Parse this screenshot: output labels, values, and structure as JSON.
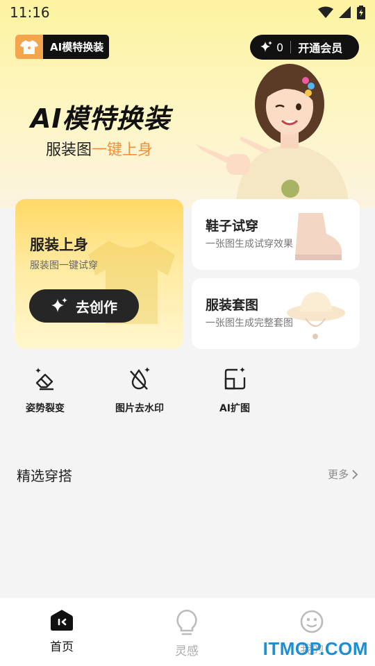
{
  "status_bar": {
    "time": "11:16"
  },
  "header": {
    "app_badge_label": "AI模特换装",
    "credits_count": "0",
    "vip_button_label": "开通会员"
  },
  "hero": {
    "title": "AI模特换装",
    "subtitle_plain": "服装图",
    "subtitle_accent": "一键上身"
  },
  "features": {
    "main": {
      "title": "服装上身",
      "subtitle": "服装图一键试穿",
      "button_label": "去创作"
    },
    "shoes": {
      "title": "鞋子试穿",
      "subtitle": "一张图生成试穿效果"
    },
    "outfit_set": {
      "title": "服装套图",
      "subtitle": "一张图生成完整套图"
    }
  },
  "tools": [
    {
      "label": "姿势裂变",
      "icon": "eraser-sparkle-icon"
    },
    {
      "label": "图片去水印",
      "icon": "no-droplet-icon"
    },
    {
      "label": "AI扩图",
      "icon": "expand-image-icon"
    }
  ],
  "section": {
    "title": "精选穿搭",
    "more_label": "更多"
  },
  "bottom_nav": [
    {
      "label": "首页",
      "icon": "home-icon",
      "active": true
    },
    {
      "label": "灵感",
      "icon": "lightbulb-icon",
      "active": false
    },
    {
      "label": "我的",
      "icon": "smiley-icon",
      "active": false
    }
  ],
  "watermark": "ITMOP.COM",
  "colors": {
    "accent_orange": "#f2913b",
    "dark": "#111111",
    "hero_yellow": "#fdf3a0",
    "watermark_blue": "#1a8fd6"
  }
}
